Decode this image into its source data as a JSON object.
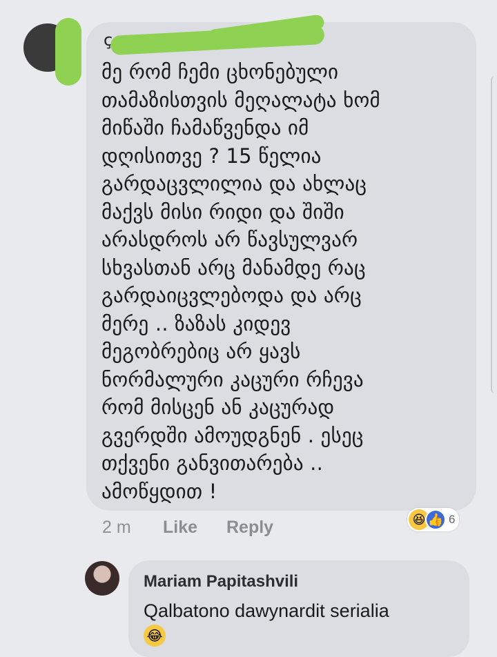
{
  "comment": {
    "author_partial": "ç",
    "text": "მე რომ ჩემი ცხონებული\nთამაზისთვის მეღალატა ხომ\nმიწაში ჩამაწვენდა იმ\nდღისითვე ? 15 წელია\nგარდაცვლილია და ახლაც\nმაქვს მისი რიდი და შიში\nარასდროს არ წავსულვარ\nსხვასთან არც მანამდე რაც\nგარდაიცვლებოდა და არც\nმერე .. ზაზას კიდევ\nმეგობრებიც არ ყავს\nნორმალური კაცური რჩევა\nრომ მისცენ ან კაცურად\nგვერდში ამოუდგნენ  . ესეც\nთქვენი განვითარება ..\nამოწყდით !",
    "time": "2 m",
    "like_label": "Like",
    "reply_label": "Reply",
    "reaction_count": "6",
    "reaction_icons": [
      "haha-icon",
      "like-icon"
    ]
  },
  "reply": {
    "author": "Mariam Papitashvili",
    "text": "Qalbatono dawynardit serialia",
    "emoji": "laughing-tears-icon"
  },
  "colors": {
    "background": "#e9eaee",
    "bubble": "#dcdde2",
    "redaction": "#8fd152",
    "like_blue": "#3d6ad6",
    "haha_yellow": "#f6c945"
  }
}
